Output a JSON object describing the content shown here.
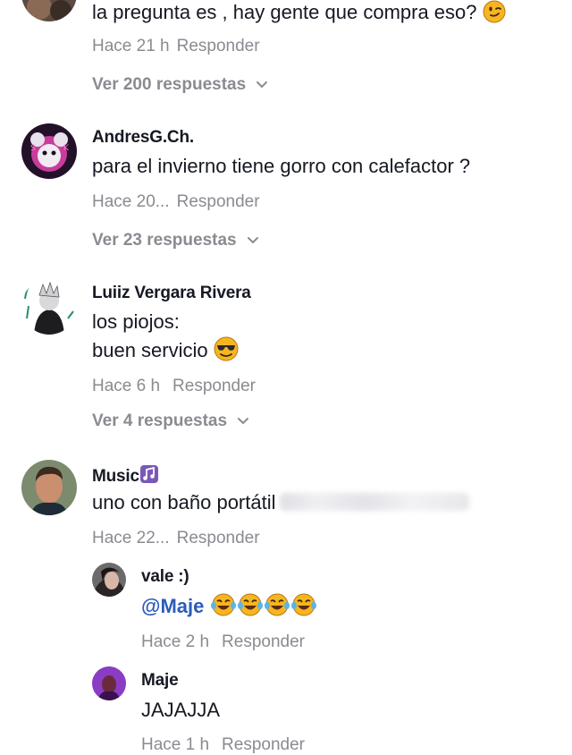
{
  "comments": [
    {
      "text": "la pregunta es , hay gente que compra eso?",
      "time": "Hace 21 h",
      "reply": "Responder",
      "view_replies": "Ver 200 respuestas"
    },
    {
      "username": "AndresG.Ch.",
      "text": "para el invierno tiene gorro con calefactor ?",
      "time": "Hace 20...",
      "reply": "Responder",
      "view_replies": "Ver 23 respuestas"
    },
    {
      "username": "Luiiz Vergara Rivera",
      "text_line1": "los piojos:",
      "text_line2": "buen servicio",
      "time": "Hace 6 h",
      "reply": "Responder",
      "view_replies": "Ver 4 respuestas"
    },
    {
      "username": "Music",
      "text": "uno con baño portátil",
      "time": "Hace 22...",
      "reply": "Responder",
      "replies": [
        {
          "username": "vale :)",
          "mention": "@Maje",
          "time": "Hace 2 h",
          "reply": "Responder"
        },
        {
          "username": "Maje",
          "text": "JAJAJJA",
          "time": "Hace 1 h",
          "reply": "Responder"
        }
      ]
    }
  ],
  "icons": {
    "wink": "winking-face-emoji",
    "sunglasses": "smiling-face-with-sunglasses-emoji",
    "laugh": "face-with-tears-of-joy-emoji",
    "music": "musical-note-emoji",
    "chevron": "chevron-down-icon"
  },
  "colors": {
    "text": "#161823",
    "secondary": "#8a8b91",
    "mention": "#2b5db9",
    "emoji_yellow": "#f7b521"
  }
}
